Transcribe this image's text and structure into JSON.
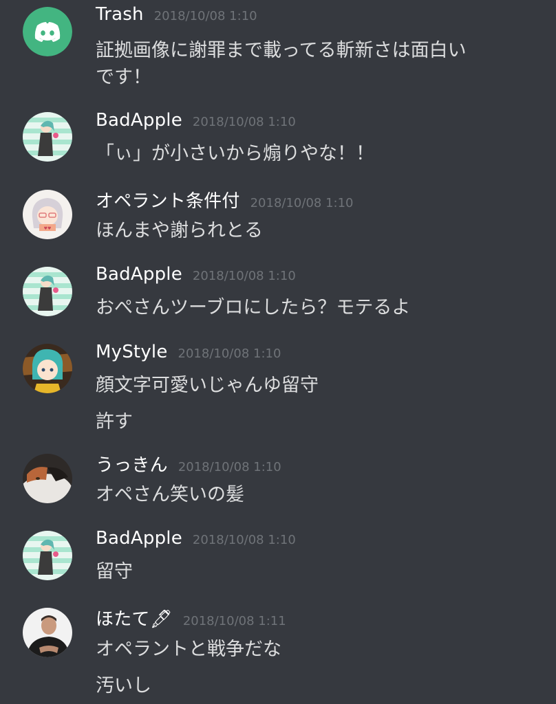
{
  "messages": [
    {
      "author": "Trash",
      "timestamp": "2018/10/08 1:10",
      "lines": [
        "証拠画像に謝罪まで載ってる斬新さは面白い",
        "です！"
      ]
    },
    {
      "author": "BadApple",
      "timestamp": "2018/10/08 1:10",
      "lines": [
        "「ぃ」が小さいから煽りやな！！"
      ]
    },
    {
      "author": "オペラント条件付",
      "timestamp": "2018/10/08 1:10",
      "lines": [
        "ほんまや謝られとる"
      ]
    },
    {
      "author": "BadApple",
      "timestamp": "2018/10/08 1:10",
      "lines": [
        "おぺさんツーブロにしたら？モテるよ"
      ]
    },
    {
      "author": "MyStyle",
      "timestamp": "2018/10/08 1:10",
      "lines": [
        "顔文字可愛いじゃんゆ留守",
        "許す"
      ]
    },
    {
      "author": "うっきん",
      "timestamp": "2018/10/08 1:10",
      "lines": [
        "オペさん笑いの髪"
      ]
    },
    {
      "author": "BadApple",
      "timestamp": "2018/10/08 1:10",
      "lines": [
        "留守"
      ]
    },
    {
      "author": "ほたて🖋",
      "timestamp": "2018/10/08 1:11",
      "lines": [
        "オペラントと戦争だな",
        "汚いし"
      ]
    }
  ],
  "colors": {
    "background": "#36393f",
    "username": "#ffffff",
    "message_text": "#dcddde",
    "timestamp": "#72767d",
    "discord_brand": "#43b581"
  }
}
